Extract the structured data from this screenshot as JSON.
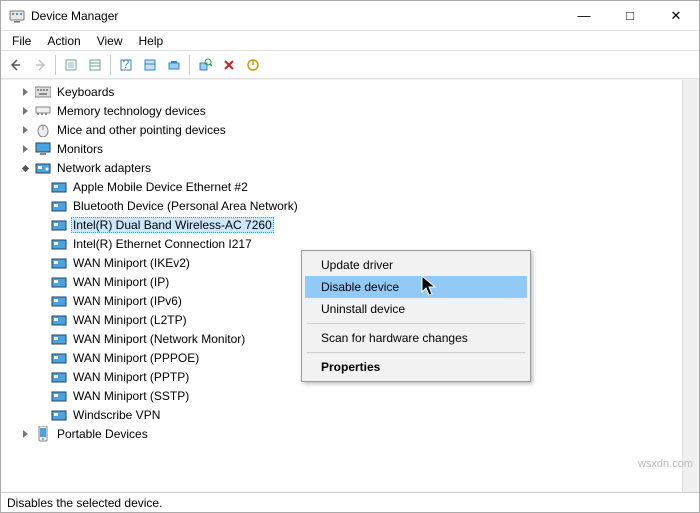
{
  "window": {
    "title": "Device Manager",
    "min": "—",
    "max": "□",
    "close": "✕"
  },
  "menu": {
    "file": "File",
    "action": "Action",
    "view": "View",
    "help": "Help"
  },
  "tree": {
    "cat": {
      "keyboards": "Keyboards",
      "memory": "Memory technology devices",
      "mice": "Mice and other pointing devices",
      "monitors": "Monitors",
      "network": "Network adapters",
      "portable": "Portable Devices"
    },
    "net": {
      "0": "Apple Mobile Device Ethernet #2",
      "1": "Bluetooth Device (Personal Area Network)",
      "2": "Intel(R) Dual Band Wireless-AC 7260",
      "3": "Intel(R) Ethernet Connection I217",
      "4": "WAN Miniport (IKEv2)",
      "5": "WAN Miniport (IP)",
      "6": "WAN Miniport (IPv6)",
      "7": "WAN Miniport (L2TP)",
      "8": "WAN Miniport (Network Monitor)",
      "9": "WAN Miniport (PPPOE)",
      "10": "WAN Miniport (PPTP)",
      "11": "WAN Miniport (SSTP)",
      "12": "Windscribe VPN"
    }
  },
  "context": {
    "update": "Update driver",
    "disable": "Disable device",
    "uninstall": "Uninstall device",
    "scan": "Scan for hardware changes",
    "properties": "Properties"
  },
  "status": "Disables the selected device.",
  "watermark": "wsxdn.com"
}
